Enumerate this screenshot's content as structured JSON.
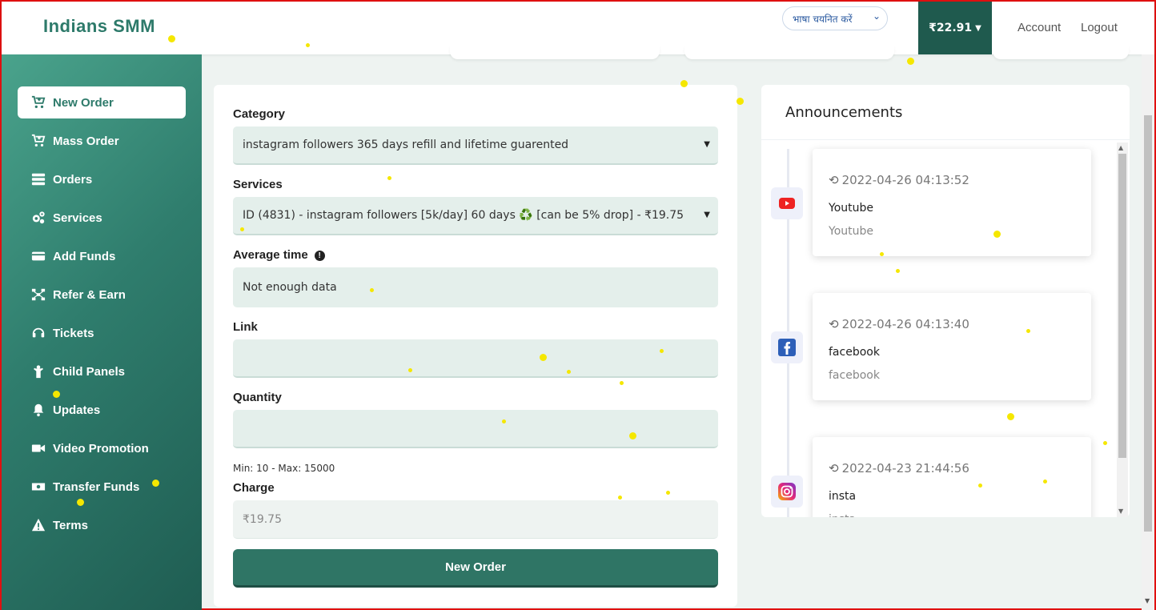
{
  "brand": "Indians SMM",
  "header": {
    "language_select": "भाषा चयनित करें",
    "balance": "₹22.91",
    "account": "Account",
    "logout": "Logout"
  },
  "sidebar": {
    "items": [
      {
        "label": "New Order",
        "icon": "cart-plus-icon"
      },
      {
        "label": "Mass Order",
        "icon": "cart-plus-icon"
      },
      {
        "label": "Orders",
        "icon": "server-icon"
      },
      {
        "label": "Services",
        "icon": "cogs-icon"
      },
      {
        "label": "Add Funds",
        "icon": "credit-card-icon"
      },
      {
        "label": "Refer & Earn",
        "icon": "network-icon"
      },
      {
        "label": "Tickets",
        "icon": "headset-icon"
      },
      {
        "label": "Child Panels",
        "icon": "child-icon"
      },
      {
        "label": "Updates",
        "icon": "bell-icon"
      },
      {
        "label": "Video Promotion",
        "icon": "video-icon"
      },
      {
        "label": "Transfer Funds",
        "icon": "money-bill-icon"
      },
      {
        "label": "Terms",
        "icon": "warning-icon"
      }
    ]
  },
  "order_form": {
    "category_label": "Category",
    "category_value": "instagram followers 365 days refill and lifetime guarented",
    "services_label": "Services",
    "services_value": "ID (4831) - instagram followers [5k/day] 60 days ♻️ [can be 5% drop] - ₹19.75",
    "average_time_label": "Average time",
    "average_time_value": "Not enough data",
    "link_label": "Link",
    "link_value": "",
    "quantity_label": "Quantity",
    "quantity_value": "",
    "quantity_hint": "Min: 10 - Max: 15000",
    "charge_label": "Charge",
    "charge_value": "₹19.75",
    "submit_label": "New Order"
  },
  "announcements": {
    "title": "Announcements",
    "items": [
      {
        "date": "2022-04-26 04:13:52",
        "name": "Youtube",
        "desc": "Youtube",
        "icon": "youtube-icon"
      },
      {
        "date": "2022-04-26 04:13:40",
        "name": "facebook",
        "desc": "facebook",
        "icon": "facebook-icon"
      },
      {
        "date": "2022-04-23 21:44:56",
        "name": "insta",
        "desc": "insta",
        "icon": "instagram-icon"
      }
    ]
  },
  "colors": {
    "brand": "#2d7a6a",
    "sidebar_dark": "#1f5d52",
    "button": "#2f7565",
    "field_bg": "#e4efeb"
  }
}
